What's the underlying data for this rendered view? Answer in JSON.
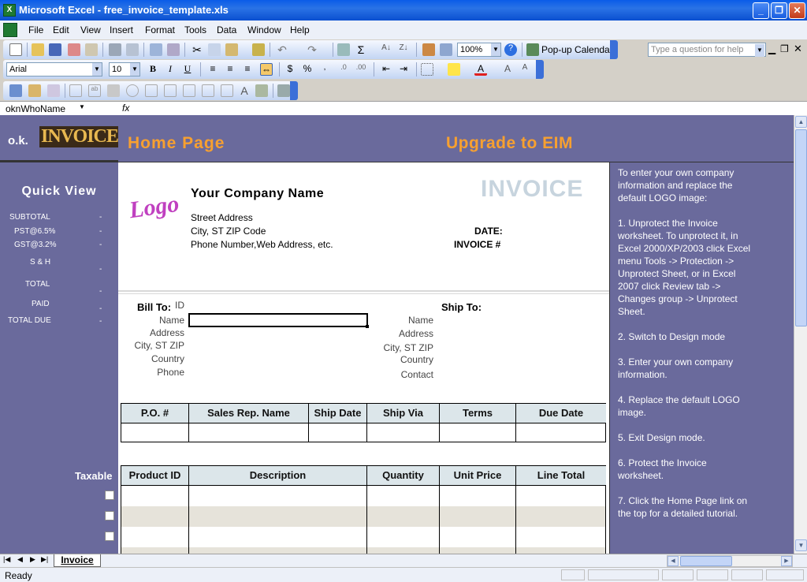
{
  "window": {
    "title": "Microsoft Excel - free_invoice_template.xls",
    "app_icon": "excel-icon"
  },
  "menu": {
    "items": [
      "File",
      "Edit",
      "View",
      "Insert",
      "Format",
      "Tools",
      "Data",
      "Window",
      "Help"
    ],
    "question_placeholder": "Type a question for help"
  },
  "toolbar": {
    "zoom": "100%",
    "popup_calendar": "Pop-up Calendar",
    "font": "Arial",
    "font_size": "10"
  },
  "formula_bar": {
    "name_box": "oknWhoName",
    "fx": "fx",
    "content": ""
  },
  "sheet": {
    "logo_prefix": "o.k.",
    "logo_word": "INVOICE",
    "home_link": "Home Page",
    "upgrade_link": "Upgrade to EIM",
    "quick_view": {
      "title": "Quick  View",
      "rows": [
        {
          "label": "SUBTOTAL",
          "value": "-"
        },
        {
          "label": "PST@6.5%",
          "value": "-"
        },
        {
          "label": "GST@3.2%",
          "value": "-"
        },
        {
          "label": "S & H",
          "value": "-"
        },
        {
          "label": "TOTAL",
          "value": "-"
        },
        {
          "label": "PAID",
          "value": "-"
        },
        {
          "label": "TOTAL DUE",
          "value": "-"
        }
      ],
      "taxable_label": "Taxable"
    },
    "invoice": {
      "logo_text": "Logo",
      "company_name": "Your Company Name",
      "invoice_word": "INVOICE",
      "street": "Street Address",
      "city": "City, ST  ZIP Code",
      "phone": "Phone Number,Web Address, etc.",
      "date_label": "DATE:",
      "invoice_no_label": "INVOICE #",
      "bill_to": {
        "title": "Bill To:",
        "id_label": "ID",
        "fields": [
          "Name",
          "Address",
          "City, ST ZIP",
          "Country",
          "Phone"
        ]
      },
      "ship_to": {
        "title": "Ship To:",
        "fields": [
          "Name",
          "Address",
          "City, ST ZIP",
          "Country",
          "Contact"
        ]
      },
      "order_headers": [
        "P.O. #",
        "Sales Rep. Name",
        "Ship Date",
        "Ship Via",
        "Terms",
        "Due Date"
      ],
      "item_headers": [
        "Product ID",
        "Description",
        "Quantity",
        "Unit Price",
        "Line Total"
      ]
    },
    "instructions": {
      "intro": "To enter your own company information and replace the default LOGO image:",
      "steps": [
        "1. Unprotect the Invoice worksheet. To unprotect it, in Excel 2000/XP/2003 click Excel menu Tools -> Protection -> Unprotect Sheet, or in Excel 2007 click Review tab -> Changes group -> Unprotect Sheet.",
        "2. Switch to Design mode",
        "3. Enter your own company information.",
        "4. Replace the default LOGO image.",
        "5. Exit Design mode.",
        "6. Protect the Invoice worksheet.",
        "7. Click the Home Page link on the top for a detailed tutorial."
      ]
    }
  },
  "sheet_tabs": [
    "Invoice"
  ],
  "status": {
    "text": "Ready"
  }
}
